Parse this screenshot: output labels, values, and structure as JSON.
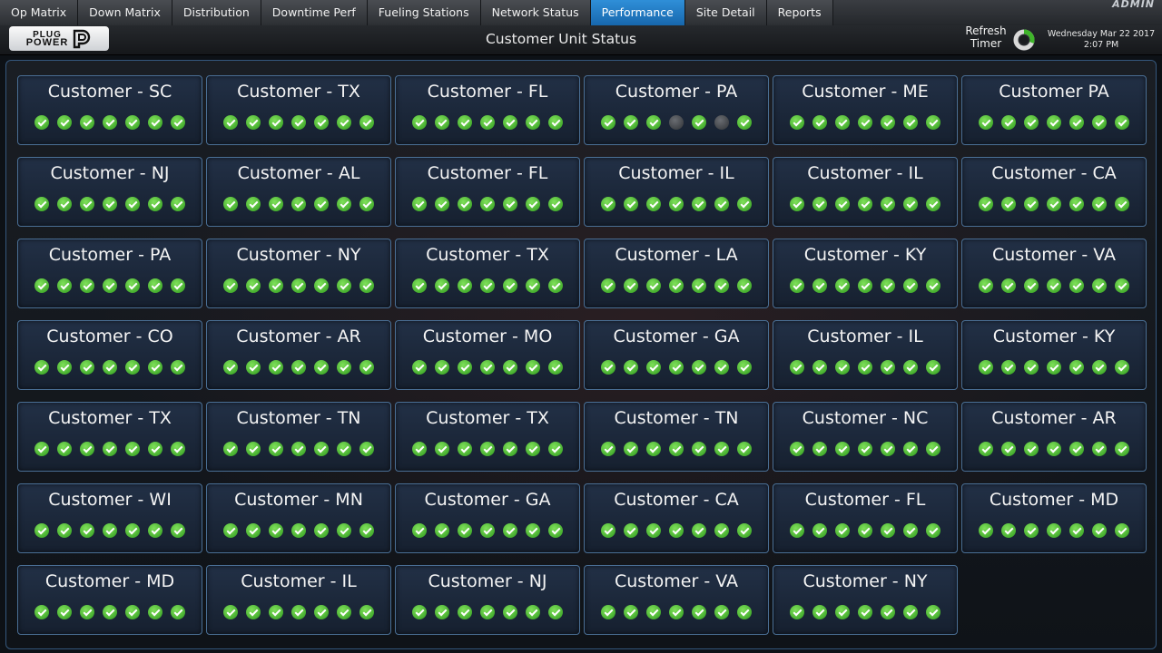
{
  "tabs": [
    {
      "label": "Op Matrix",
      "active": false
    },
    {
      "label": "Down Matrix",
      "active": false
    },
    {
      "label": "Distribution",
      "active": false
    },
    {
      "label": "Downtime Perf",
      "active": false
    },
    {
      "label": "Fueling Stations",
      "active": false
    },
    {
      "label": "Network Status",
      "active": false
    },
    {
      "label": "Performance",
      "active": true
    },
    {
      "label": "Site Detail",
      "active": false
    },
    {
      "label": "Reports",
      "active": false
    }
  ],
  "user_label": "ADMIN",
  "header": {
    "logo_line1": "PLUG",
    "logo_line2": "POWER",
    "title": "Customer Unit Status",
    "refresh_line1": "Refresh",
    "refresh_line2": "Timer",
    "date": "Wednesday Mar 22 2017",
    "time": "2:07 PM"
  },
  "colors": {
    "accent": "#1f7cc4",
    "ok": "#3fb52a",
    "off": "#4a4d52",
    "card_border": "#4a6f95"
  },
  "customers": [
    {
      "name": "Customer - SC",
      "status": [
        "ok",
        "ok",
        "ok",
        "ok",
        "ok",
        "ok",
        "ok"
      ]
    },
    {
      "name": "Customer - TX",
      "status": [
        "ok",
        "ok",
        "ok",
        "ok",
        "ok",
        "ok",
        "ok"
      ]
    },
    {
      "name": "Customer - FL",
      "status": [
        "ok",
        "ok",
        "ok",
        "ok",
        "ok",
        "ok",
        "ok"
      ]
    },
    {
      "name": "Customer - PA",
      "status": [
        "ok",
        "ok",
        "ok",
        "off",
        "ok",
        "off",
        "ok"
      ]
    },
    {
      "name": "Customer - ME",
      "status": [
        "ok",
        "ok",
        "ok",
        "ok",
        "ok",
        "ok",
        "ok"
      ]
    },
    {
      "name": "Customer PA",
      "status": [
        "ok",
        "ok",
        "ok",
        "ok",
        "ok",
        "ok",
        "ok"
      ]
    },
    {
      "name": "Customer - NJ",
      "status": [
        "ok",
        "ok",
        "ok",
        "ok",
        "ok",
        "ok",
        "ok"
      ]
    },
    {
      "name": "Customer - AL",
      "status": [
        "ok",
        "ok",
        "ok",
        "ok",
        "ok",
        "ok",
        "ok"
      ]
    },
    {
      "name": "Customer - FL",
      "status": [
        "ok",
        "ok",
        "ok",
        "ok",
        "ok",
        "ok",
        "ok"
      ]
    },
    {
      "name": "Customer - IL",
      "status": [
        "ok",
        "ok",
        "ok",
        "ok",
        "ok",
        "ok",
        "ok"
      ]
    },
    {
      "name": "Customer - IL",
      "status": [
        "ok",
        "ok",
        "ok",
        "ok",
        "ok",
        "ok",
        "ok"
      ]
    },
    {
      "name": "Customer - CA",
      "status": [
        "ok",
        "ok",
        "ok",
        "ok",
        "ok",
        "ok",
        "ok"
      ]
    },
    {
      "name": "Customer - PA",
      "status": [
        "ok",
        "ok",
        "ok",
        "ok",
        "ok",
        "ok",
        "ok"
      ]
    },
    {
      "name": "Customer - NY",
      "status": [
        "ok",
        "ok",
        "ok",
        "ok",
        "ok",
        "ok",
        "ok"
      ]
    },
    {
      "name": "Customer - TX",
      "status": [
        "ok",
        "ok",
        "ok",
        "ok",
        "ok",
        "ok",
        "ok"
      ]
    },
    {
      "name": "Customer - LA",
      "status": [
        "ok",
        "ok",
        "ok",
        "ok",
        "ok",
        "ok",
        "ok"
      ]
    },
    {
      "name": "Customer - KY",
      "status": [
        "ok",
        "ok",
        "ok",
        "ok",
        "ok",
        "ok",
        "ok"
      ]
    },
    {
      "name": "Customer - VA",
      "status": [
        "ok",
        "ok",
        "ok",
        "ok",
        "ok",
        "ok",
        "ok"
      ]
    },
    {
      "name": "Customer - CO",
      "status": [
        "ok",
        "ok",
        "ok",
        "ok",
        "ok",
        "ok",
        "ok"
      ]
    },
    {
      "name": "Customer - AR",
      "status": [
        "ok",
        "ok",
        "ok",
        "ok",
        "ok",
        "ok",
        "ok"
      ]
    },
    {
      "name": "Customer - MO",
      "status": [
        "ok",
        "ok",
        "ok",
        "ok",
        "ok",
        "ok",
        "ok"
      ]
    },
    {
      "name": "Customer - GA",
      "status": [
        "ok",
        "ok",
        "ok",
        "ok",
        "ok",
        "ok",
        "ok"
      ]
    },
    {
      "name": "Customer - IL",
      "status": [
        "ok",
        "ok",
        "ok",
        "ok",
        "ok",
        "ok",
        "ok"
      ]
    },
    {
      "name": "Customer - KY",
      "status": [
        "ok",
        "ok",
        "ok",
        "ok",
        "ok",
        "ok",
        "ok"
      ]
    },
    {
      "name": "Customer - TX",
      "status": [
        "ok",
        "ok",
        "ok",
        "ok",
        "ok",
        "ok",
        "ok"
      ]
    },
    {
      "name": "Customer - TN",
      "status": [
        "ok",
        "ok",
        "ok",
        "ok",
        "ok",
        "ok",
        "ok"
      ]
    },
    {
      "name": "Customer - TX",
      "status": [
        "ok",
        "ok",
        "ok",
        "ok",
        "ok",
        "ok",
        "ok"
      ]
    },
    {
      "name": "Customer - TN",
      "status": [
        "ok",
        "ok",
        "ok",
        "ok",
        "ok",
        "ok",
        "ok"
      ]
    },
    {
      "name": "Customer - NC",
      "status": [
        "ok",
        "ok",
        "ok",
        "ok",
        "ok",
        "ok",
        "ok"
      ]
    },
    {
      "name": "Customer - AR",
      "status": [
        "ok",
        "ok",
        "ok",
        "ok",
        "ok",
        "ok",
        "ok"
      ]
    },
    {
      "name": "Customer - WI",
      "status": [
        "ok",
        "ok",
        "ok",
        "ok",
        "ok",
        "ok",
        "ok"
      ]
    },
    {
      "name": "Customer - MN",
      "status": [
        "ok",
        "ok",
        "ok",
        "ok",
        "ok",
        "ok",
        "ok"
      ]
    },
    {
      "name": "Customer - GA",
      "status": [
        "ok",
        "ok",
        "ok",
        "ok",
        "ok",
        "ok",
        "ok"
      ]
    },
    {
      "name": "Customer - CA",
      "status": [
        "ok",
        "ok",
        "ok",
        "ok",
        "ok",
        "ok",
        "ok"
      ]
    },
    {
      "name": "Customer - FL",
      "status": [
        "ok",
        "ok",
        "ok",
        "ok",
        "ok",
        "ok",
        "ok"
      ]
    },
    {
      "name": "Customer - MD",
      "status": [
        "ok",
        "ok",
        "ok",
        "ok",
        "ok",
        "ok",
        "ok"
      ]
    },
    {
      "name": "Customer - MD",
      "status": [
        "ok",
        "ok",
        "ok",
        "ok",
        "ok",
        "ok",
        "ok"
      ]
    },
    {
      "name": "Customer - IL",
      "status": [
        "ok",
        "ok",
        "ok",
        "ok",
        "ok",
        "ok",
        "ok"
      ]
    },
    {
      "name": "Customer - NJ",
      "status": [
        "ok",
        "ok",
        "ok",
        "ok",
        "ok",
        "ok",
        "ok"
      ]
    },
    {
      "name": "Customer - VA",
      "status": [
        "ok",
        "ok",
        "ok",
        "ok",
        "ok",
        "ok",
        "ok"
      ]
    },
    {
      "name": "Customer - NY",
      "status": [
        "ok",
        "ok",
        "ok",
        "ok",
        "ok",
        "ok",
        "ok"
      ]
    }
  ]
}
